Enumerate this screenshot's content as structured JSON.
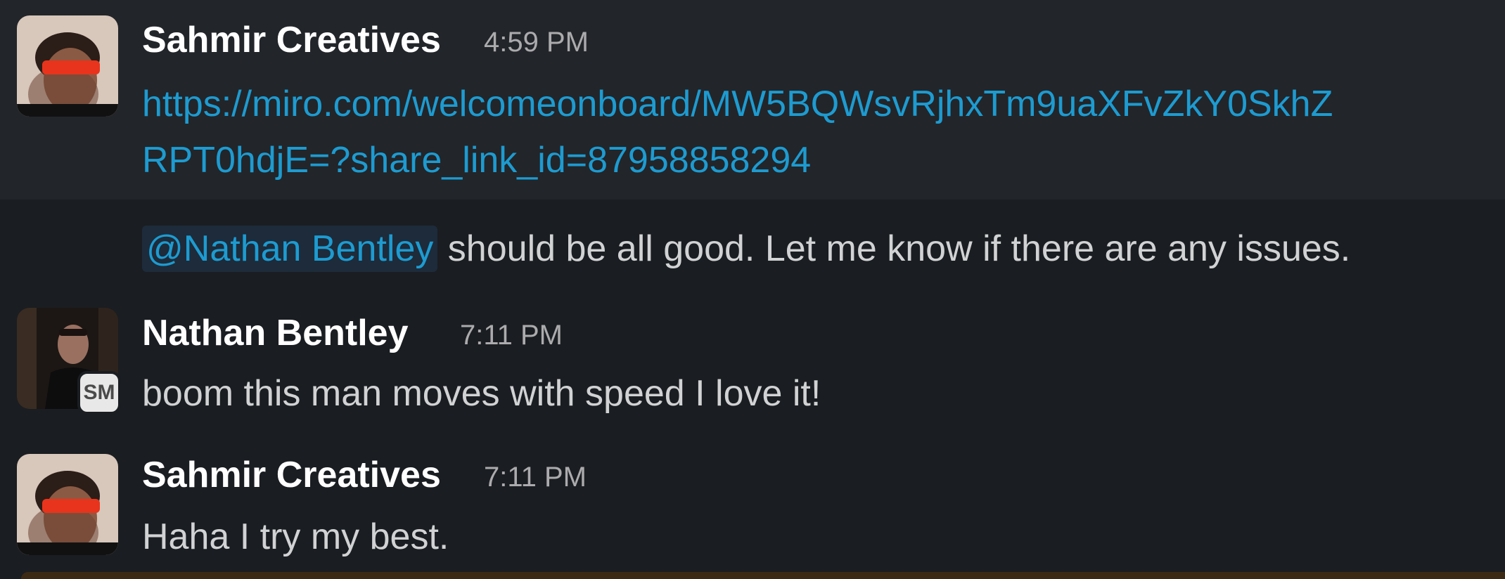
{
  "messages": [
    {
      "sender": "Sahmir Creatives",
      "time": "4:59 PM",
      "link_line1": "https://miro.com/welcomeonboard/MW5BQWsvRjhxTm9uaXFvZkY0SkhZ",
      "link_line2": "RPT0hdjE=?share_link_id=87958858294"
    },
    {
      "mention": "@Nathan Bentley",
      "text": " should be all good. Let me know if there are any issues."
    },
    {
      "sender": "Nathan Bentley",
      "time": "7:11 PM",
      "badge": "SM",
      "text": "boom this man moves with speed I love it!"
    },
    {
      "sender": "Sahmir Creatives",
      "time": "7:11 PM",
      "text": "Haha I try my best."
    }
  ],
  "colors": {
    "background": "#1a1d21",
    "hover_background": "#222529",
    "link": "#1d9bd1",
    "mention_bg": "#1d2b3a"
  }
}
